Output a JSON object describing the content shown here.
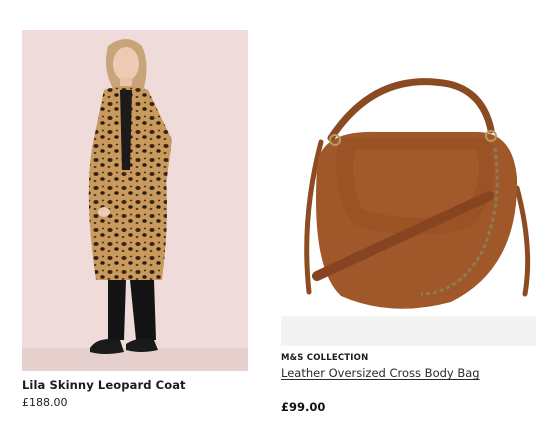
{
  "products": [
    {
      "title": "Lila Skinny Leopard Coat",
      "price": "£188.00",
      "image_alt": "model wearing leopard print coat"
    },
    {
      "brand": "M&S COLLECTION",
      "title": "Leather Oversized Cross Body Bag",
      "price": "£99.00",
      "image_alt": "tan leather cross body bag"
    }
  ],
  "colors": {
    "background": "#ffffff",
    "coat_backdrop": "#efdcda",
    "bag_leather": "#a0582a",
    "text_primary": "#1b1b1b"
  }
}
